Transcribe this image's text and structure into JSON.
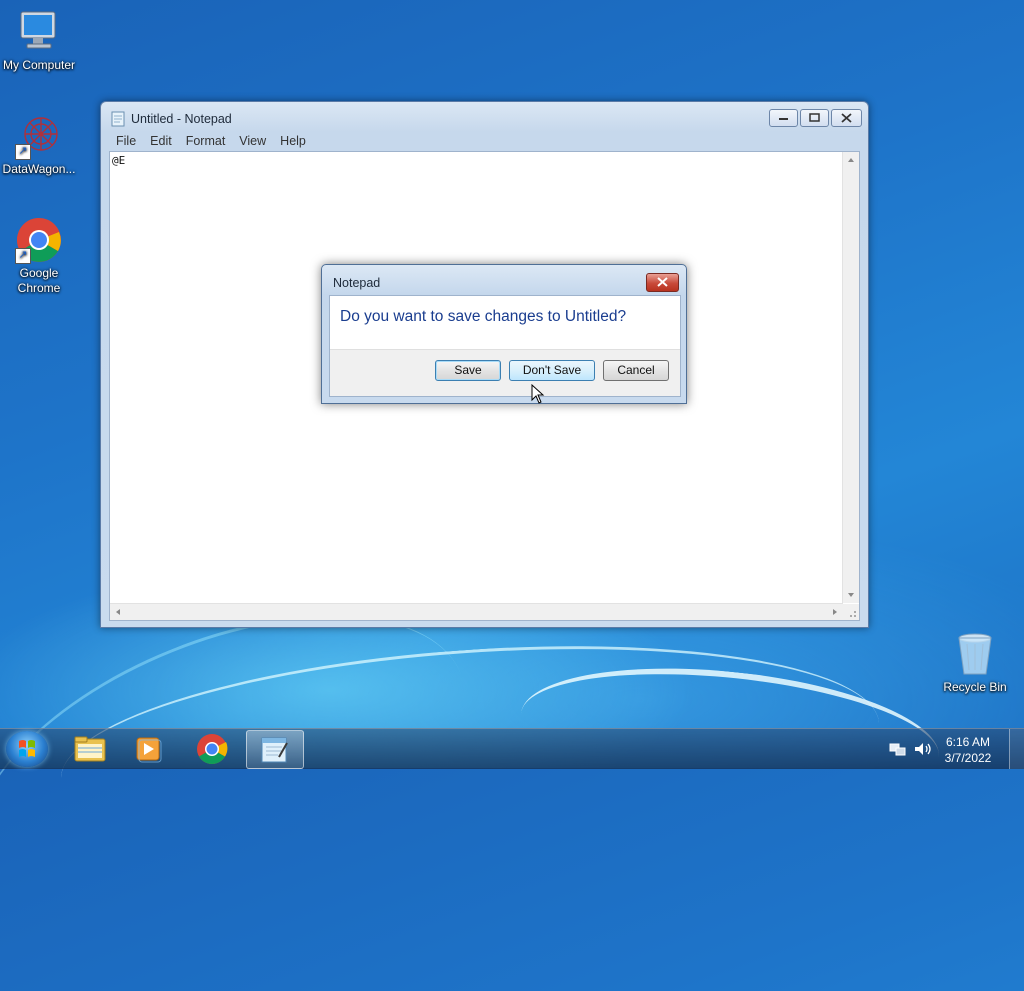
{
  "desktop": {
    "icons": [
      {
        "label": "My Computer",
        "icon": "computer-icon"
      },
      {
        "label": "DataWagon...",
        "icon": "datawagon-icon"
      },
      {
        "label": "Google Chrome",
        "icon": "chrome-icon"
      },
      {
        "label": "Recycle Bin",
        "icon": "recycle-bin-icon"
      }
    ]
  },
  "notepad": {
    "title": "Untitled - Notepad",
    "menu": [
      "File",
      "Edit",
      "Format",
      "View",
      "Help"
    ],
    "content": "@E"
  },
  "dialog": {
    "title": "Notepad",
    "message": "Do you want to save changes to Untitled?",
    "buttons": {
      "save": "Save",
      "dont_save": "Don't Save",
      "cancel": "Cancel"
    }
  },
  "taskbar": {
    "items": [
      "explorer-icon",
      "media-player-icon",
      "chrome-icon",
      "notepad-icon"
    ],
    "active_item": "notepad-icon",
    "tray_icons": [
      "network-icon",
      "volume-icon"
    ],
    "time": "6:16 AM",
    "date": "3/7/2022"
  },
  "colors": {
    "desktop_blue": "#1e74c9",
    "dialog_message": "#1a3d8f",
    "close_red": "#c84a3a"
  }
}
